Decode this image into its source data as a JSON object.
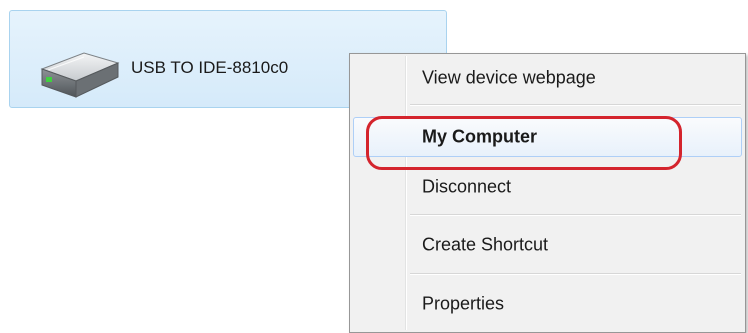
{
  "device": {
    "label": "USB TO IDE-8810c0",
    "icon": "hard-drive-icon"
  },
  "context_menu": {
    "items": [
      {
        "label": "View device webpage",
        "bold": false
      },
      {
        "label": "My Computer",
        "bold": true,
        "highlighted": true
      },
      {
        "label": "Disconnect",
        "bold": false
      },
      {
        "label": "Create Shortcut",
        "bold": false
      },
      {
        "label": "Properties",
        "bold": false
      }
    ]
  },
  "colors": {
    "highlight_ring": "#d4242d",
    "selection": "#d5eafa",
    "menu_background": "#f1f1f1"
  }
}
